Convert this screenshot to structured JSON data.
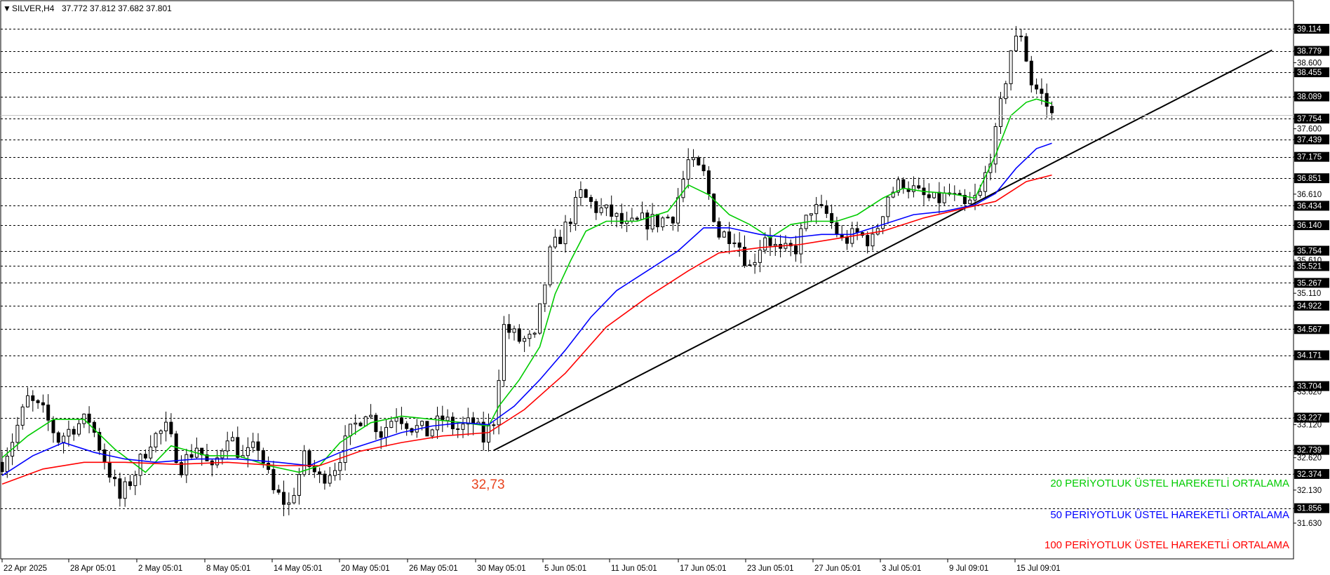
{
  "header": {
    "symbol": "SILVER,H4",
    "ohlc": "37.772 37.812 37.682 37.801"
  },
  "chart_data": {
    "type": "candlestick",
    "title": "",
    "ylim": [
      31.38,
      39.52
    ],
    "y_ticks": [
      "39.114",
      "38.779",
      "38.600",
      "38.455",
      "38.089",
      "37.754",
      "37.600",
      "37.439",
      "37.175",
      "36.851",
      "36.610",
      "36.434",
      "36.140",
      "35.754",
      "35.610",
      "35.521",
      "35.267",
      "35.110",
      "34.922",
      "34.567",
      "34.171",
      "33.704",
      "33.620",
      "33.227",
      "33.120",
      "32.739",
      "32.620",
      "32.374",
      "32.130",
      "31.856",
      "31.630"
    ],
    "horizontal_levels": [
      "39.114",
      "38.779",
      "38.455",
      "38.089",
      "37.754",
      "37.439",
      "37.175",
      "36.851",
      "36.434",
      "36.140",
      "35.754",
      "35.521",
      "35.267",
      "34.922",
      "34.567",
      "34.171",
      "33.704",
      "33.227",
      "32.739",
      "32.374",
      "31.856"
    ],
    "x_labels": [
      "22 Apr 2025",
      "28 Apr 05:01",
      "2 May 05:01",
      "8 May 05:01",
      "14 May 05:01",
      "20 May 05:01",
      "26 May 05:01",
      "30 May 05:01",
      "5 Jun 05:01",
      "11 Jun 05:01",
      "17 Jun 05:01",
      "23 Jun 05:01",
      "27 Jun 05:01",
      "3 Jul 05:01",
      "9 Jul 09:01",
      "15 Jul 09:01"
    ],
    "current_price": "37.801",
    "price_path": [
      [
        0,
        32.55
      ],
      [
        2,
        32.9
      ],
      [
        5,
        33.5
      ],
      [
        8,
        33.3
      ],
      [
        11,
        32.9
      ],
      [
        14,
        33.1
      ],
      [
        17,
        33.2
      ],
      [
        20,
        32.6
      ],
      [
        23,
        32.0
      ],
      [
        26,
        32.4
      ],
      [
        29,
        32.9
      ],
      [
        32,
        33.05
      ],
      [
        35,
        32.5
      ],
      [
        38,
        32.8
      ],
      [
        41,
        32.4
      ],
      [
        44,
        33.0
      ],
      [
        47,
        32.6
      ],
      [
        50,
        32.8
      ],
      [
        53,
        32.1
      ],
      [
        56,
        31.9
      ],
      [
        59,
        32.6
      ],
      [
        62,
        32.3
      ],
      [
        65,
        32.5
      ],
      [
        68,
        33.0
      ],
      [
        71,
        33.35
      ],
      [
        74,
        33.0
      ],
      [
        77,
        33.3
      ],
      [
        80,
        33.1
      ],
      [
        83,
        33.0
      ],
      [
        86,
        33.2
      ],
      [
        89,
        33.05
      ],
      [
        92,
        33.15
      ],
      [
        94,
        32.9
      ],
      [
        96,
        33.2
      ],
      [
        98,
        34.6
      ],
      [
        101,
        34.4
      ],
      [
        104,
        34.4
      ],
      [
        107,
        35.7
      ],
      [
        110,
        36.1
      ],
      [
        113,
        36.6
      ],
      [
        116,
        36.4
      ],
      [
        119,
        36.3
      ],
      [
        122,
        36.1
      ],
      [
        125,
        36.2
      ],
      [
        128,
        36.2
      ],
      [
        131,
        36.3
      ],
      [
        134,
        37.1
      ],
      [
        137,
        36.9
      ],
      [
        140,
        36.0
      ],
      [
        143,
        36.0
      ],
      [
        146,
        35.5
      ],
      [
        149,
        36.0
      ],
      [
        152,
        35.7
      ],
      [
        155,
        35.8
      ],
      [
        158,
        36.4
      ],
      [
        161,
        36.3
      ],
      [
        164,
        35.9
      ],
      [
        167,
        36.0
      ],
      [
        170,
        35.9
      ],
      [
        173,
        36.6
      ],
      [
        176,
        36.8
      ],
      [
        179,
        36.6
      ],
      [
        182,
        36.5
      ],
      [
        185,
        36.6
      ],
      [
        188,
        36.4
      ],
      [
        191,
        36.6
      ],
      [
        194,
        37.5
      ],
      [
        197,
        38.8
      ],
      [
        199,
        39.05
      ],
      [
        201,
        38.3
      ],
      [
        203,
        38.1
      ],
      [
        205,
        37.8
      ]
    ],
    "series": [
      {
        "name": "20 PERİYOTLUK ÜSTEL HAREKETLİ ORTALAMA",
        "color": "#00cc00",
        "points": [
          [
            0,
            32.62
          ],
          [
            5,
            32.95
          ],
          [
            10,
            33.2
          ],
          [
            16,
            33.2
          ],
          [
            22,
            32.75
          ],
          [
            28,
            32.4
          ],
          [
            33,
            32.8
          ],
          [
            40,
            32.65
          ],
          [
            46,
            32.65
          ],
          [
            52,
            32.5
          ],
          [
            58,
            32.4
          ],
          [
            62,
            32.5
          ],
          [
            66,
            32.85
          ],
          [
            72,
            33.15
          ],
          [
            78,
            33.25
          ],
          [
            84,
            33.2
          ],
          [
            90,
            33.15
          ],
          [
            95,
            33.1
          ],
          [
            97,
            33.4
          ],
          [
            101,
            33.8
          ],
          [
            105,
            34.3
          ],
          [
            108,
            35.1
          ],
          [
            111,
            35.6
          ],
          [
            114,
            36.05
          ],
          [
            118,
            36.2
          ],
          [
            124,
            36.2
          ],
          [
            130,
            36.35
          ],
          [
            134,
            36.75
          ],
          [
            138,
            36.6
          ],
          [
            142,
            36.3
          ],
          [
            146,
            36.15
          ],
          [
            150,
            35.95
          ],
          [
            154,
            36.15
          ],
          [
            158,
            36.2
          ],
          [
            163,
            36.2
          ],
          [
            167,
            36.3
          ],
          [
            172,
            36.55
          ],
          [
            176,
            36.7
          ],
          [
            180,
            36.65
          ],
          [
            185,
            36.62
          ],
          [
            190,
            36.55
          ],
          [
            194,
            37.2
          ],
          [
            197,
            37.8
          ],
          [
            200,
            38.0
          ],
          [
            202,
            38.05
          ],
          [
            205,
            37.98
          ]
        ]
      },
      {
        "name": "50 PERİYOTLUK ÜSTEL HAREKETLİ ORTALAMA",
        "color": "#0000ff",
        "points": [
          [
            0,
            32.35
          ],
          [
            6,
            32.65
          ],
          [
            12,
            32.85
          ],
          [
            18,
            32.7
          ],
          [
            24,
            32.6
          ],
          [
            30,
            32.55
          ],
          [
            38,
            32.6
          ],
          [
            46,
            32.6
          ],
          [
            54,
            32.55
          ],
          [
            60,
            32.5
          ],
          [
            66,
            32.7
          ],
          [
            72,
            32.85
          ],
          [
            78,
            33.0
          ],
          [
            84,
            33.1
          ],
          [
            90,
            33.15
          ],
          [
            95,
            33.12
          ],
          [
            100,
            33.4
          ],
          [
            105,
            33.8
          ],
          [
            110,
            34.25
          ],
          [
            115,
            34.75
          ],
          [
            120,
            35.15
          ],
          [
            126,
            35.45
          ],
          [
            132,
            35.75
          ],
          [
            137,
            36.1
          ],
          [
            142,
            36.1
          ],
          [
            148,
            36.0
          ],
          [
            154,
            35.95
          ],
          [
            160,
            36.0
          ],
          [
            166,
            36.0
          ],
          [
            172,
            36.15
          ],
          [
            178,
            36.3
          ],
          [
            184,
            36.35
          ],
          [
            190,
            36.45
          ],
          [
            194,
            36.62
          ],
          [
            198,
            37.0
          ],
          [
            202,
            37.3
          ],
          [
            205,
            37.38
          ]
        ]
      },
      {
        "name": "100 PERİYOTLUK ÜSTEL HAREKETLİ ORTALAMA",
        "color": "#ff0000",
        "points": [
          [
            0,
            32.22
          ],
          [
            8,
            32.45
          ],
          [
            16,
            32.55
          ],
          [
            24,
            32.55
          ],
          [
            34,
            32.52
          ],
          [
            44,
            32.55
          ],
          [
            54,
            32.5
          ],
          [
            62,
            32.5
          ],
          [
            70,
            32.72
          ],
          [
            78,
            32.85
          ],
          [
            86,
            32.95
          ],
          [
            95,
            33.0
          ],
          [
            102,
            33.35
          ],
          [
            110,
            33.9
          ],
          [
            118,
            34.6
          ],
          [
            126,
            35.05
          ],
          [
            134,
            35.45
          ],
          [
            140,
            35.72
          ],
          [
            148,
            35.8
          ],
          [
            156,
            35.85
          ],
          [
            164,
            35.95
          ],
          [
            172,
            36.05
          ],
          [
            180,
            36.25
          ],
          [
            188,
            36.4
          ],
          [
            194,
            36.5
          ],
          [
            200,
            36.8
          ],
          [
            205,
            36.9
          ]
        ]
      }
    ],
    "trendline": {
      "start": [
        96,
        32.73
      ],
      "end": [
        248,
        38.79
      ],
      "color": "#000000"
    },
    "annotation": "32,73",
    "legend": [
      "20 PERİYOTLUK ÜSTEL HAREKETLİ ORTALAMA",
      "50 PERİYOTLUK ÜSTEL HAREKETLİ ORTALAMA",
      "100 PERİYOTLUK ÜSTEL HAREKETLİ ORTALAMA"
    ],
    "legend_placement": "bottom-right",
    "grid": "horizontal-dashed"
  }
}
